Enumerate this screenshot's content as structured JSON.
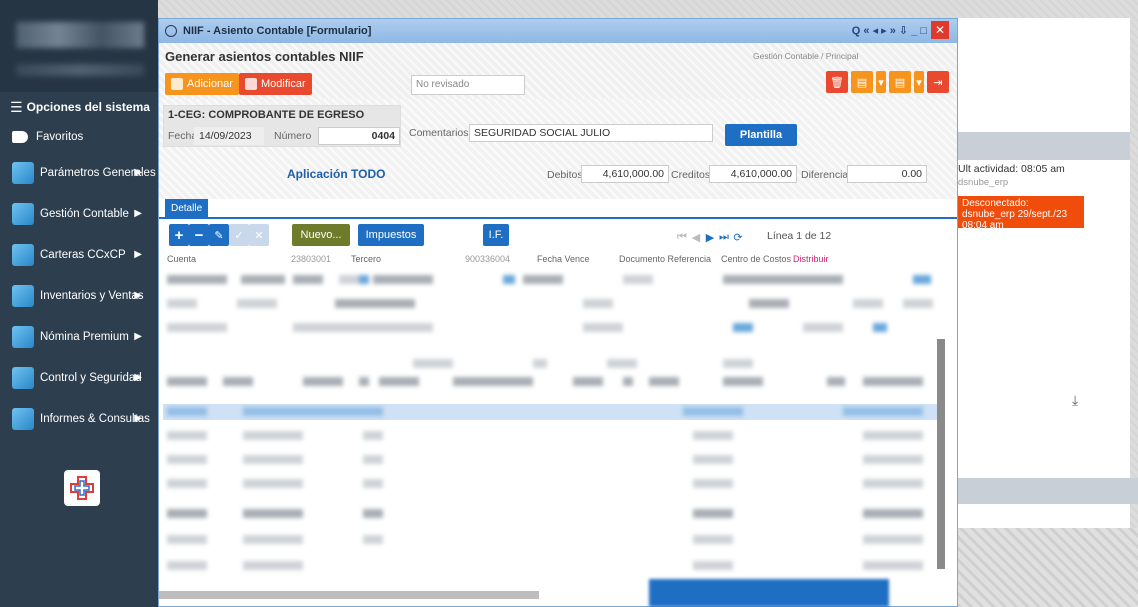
{
  "sidebar": {
    "title": "Opciones del sistema",
    "favorites": "Favoritos",
    "items": [
      {
        "label": "Parámetros Generales"
      },
      {
        "label": "Gestión Contable"
      },
      {
        "label": "Carteras CCxCP"
      },
      {
        "label": "Inventarios y Ventas"
      },
      {
        "label": "Nómina Premium"
      },
      {
        "label": "Control y Seguridad"
      },
      {
        "label": "Informes & Consultas"
      }
    ]
  },
  "window": {
    "title": "NIIF - Asiento Contable [Formulario]",
    "controls": "Q « ◂ ▸ » ⇩ _ □",
    "close": "✕"
  },
  "header": {
    "title": "Generar asientos contables NIIF",
    "breadcrumb": "Gestión Contable / Principal",
    "add_label": "Adicionar",
    "modify_label": "Modificar",
    "status": "No revisado"
  },
  "document": {
    "type": "1-CEG: COMPROBANTE DE EGRESO",
    "fecha_label": "Fecha",
    "fecha": "14/09/2023",
    "numero_label": "Número",
    "numero": "0404",
    "comentarios_label": "Comentarios",
    "comentarios": "SEGURIDAD SOCIAL JULIO",
    "plantilla_label": "Plantilla",
    "aplicacion": "Aplicación TODO",
    "debitos_label": "Debitos",
    "debitos": "4,610,000.00",
    "creditos_label": "Creditos",
    "creditos": "4,610,000.00",
    "diferencia_label": "Diferencia",
    "diferencia": "0.00"
  },
  "detail": {
    "tab": "Detalle",
    "nuevo": "Nuevo...",
    "impuestos": "Impuestos",
    "if": "I.F.",
    "linea": "Línea 1 de 12",
    "columns": {
      "cuenta": "Cuenta",
      "cuenta_val": "23803001",
      "tercero": "Tercero",
      "tercero_val": "900336004",
      "fecha_vence": "Fecha Vence",
      "doc_ref": "Documento Referencia",
      "centro": "Centro de Costos",
      "distrib": "Distribuir"
    }
  },
  "rightpanel": {
    "last_activity": "Ult actividad: 08:05 am",
    "user": "dsnube_erp",
    "disconnected": "Desconectado: dsnube_erp 29/sept./23 08:04 am"
  },
  "colors": {
    "sidebar": "#2d3e4f",
    "accent_blue": "#1e6fc4",
    "orange": "#f7941d",
    "red": "#e8492f",
    "alert": "#f04d0c"
  }
}
